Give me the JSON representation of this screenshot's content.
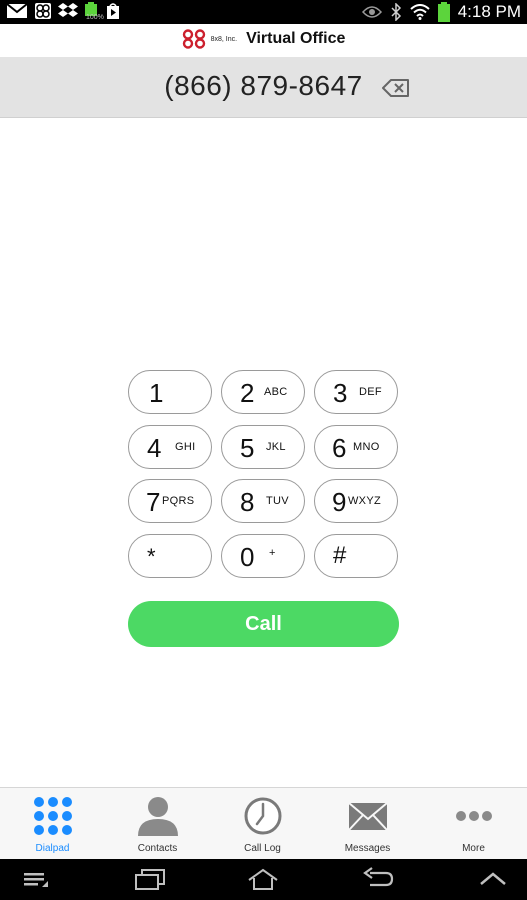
{
  "status_bar": {
    "time": "4:18 PM",
    "battery_label": "100%"
  },
  "header": {
    "company_small": "8x8, Inc.",
    "app_name": "Virtual Office"
  },
  "dialer": {
    "number": "(866) 879-8647"
  },
  "keypad": [
    {
      "digit": "1",
      "letters": ""
    },
    {
      "digit": "2",
      "letters": "ABC"
    },
    {
      "digit": "3",
      "letters": "DEF"
    },
    {
      "digit": "4",
      "letters": "GHI"
    },
    {
      "digit": "5",
      "letters": "JKL"
    },
    {
      "digit": "6",
      "letters": "MNO"
    },
    {
      "digit": "7",
      "letters": "PQRS"
    },
    {
      "digit": "8",
      "letters": "TUV"
    },
    {
      "digit": "9",
      "letters": "WXYZ"
    },
    {
      "digit": "*",
      "letters": ""
    },
    {
      "digit": "0",
      "letters": "+"
    },
    {
      "digit": "#",
      "letters": ""
    }
  ],
  "call_label": "Call",
  "tabs": [
    {
      "label": "Dialpad",
      "icon": "dialpad-icon",
      "active": true
    },
    {
      "label": "Contacts",
      "icon": "contact-person-icon",
      "active": false
    },
    {
      "label": "Call Log",
      "icon": "clock-icon",
      "active": false
    },
    {
      "label": "Messages",
      "icon": "envelope-icon",
      "active": false
    },
    {
      "label": "More",
      "icon": "more-dots-icon",
      "active": false
    }
  ],
  "colors": {
    "accent": "#1a8cff",
    "call": "#4cd964",
    "logo": "#cc1f2d"
  }
}
